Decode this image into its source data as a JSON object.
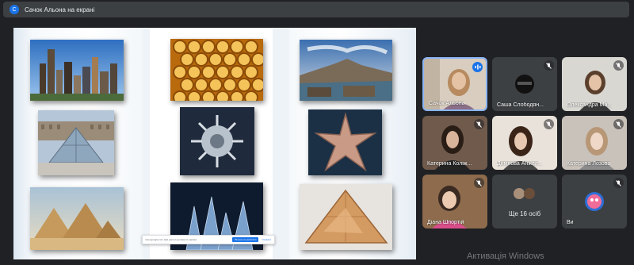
{
  "top_bar": {
    "presenter_initial": "С",
    "presenter_text": "Сачок Альона на екрані"
  },
  "screen_share": {
    "banner_text": "meet.google.com має доступ до вашого екрана.",
    "stop_label": "Більше не ділитися",
    "hide_label": "Сховати"
  },
  "participants": [
    {
      "name": "Сачок Альона",
      "speaking": true
    },
    {
      "name": "Саша Слободян...",
      "muted": true
    },
    {
      "name": "Олександра Ма...",
      "muted": true
    },
    {
      "name": "Катерина Коліж...",
      "muted": true
    },
    {
      "name": "Димнова Анжел...",
      "muted": true
    },
    {
      "name": "Катерина Лозова",
      "muted": true
    },
    {
      "name": "Діана Шпортій",
      "muted": true
    },
    {
      "more_text": "Ще 16 осіб"
    },
    {
      "name": "Ви",
      "muted": true
    }
  ],
  "watermark": "Активація Windows",
  "colors": {
    "background": "#202124",
    "tile": "#3c4043",
    "accent": "#1a73e8",
    "active_border": "#8ab4f8"
  },
  "icons": [
    "mic-off-icon",
    "speaking-indicator-icon"
  ]
}
